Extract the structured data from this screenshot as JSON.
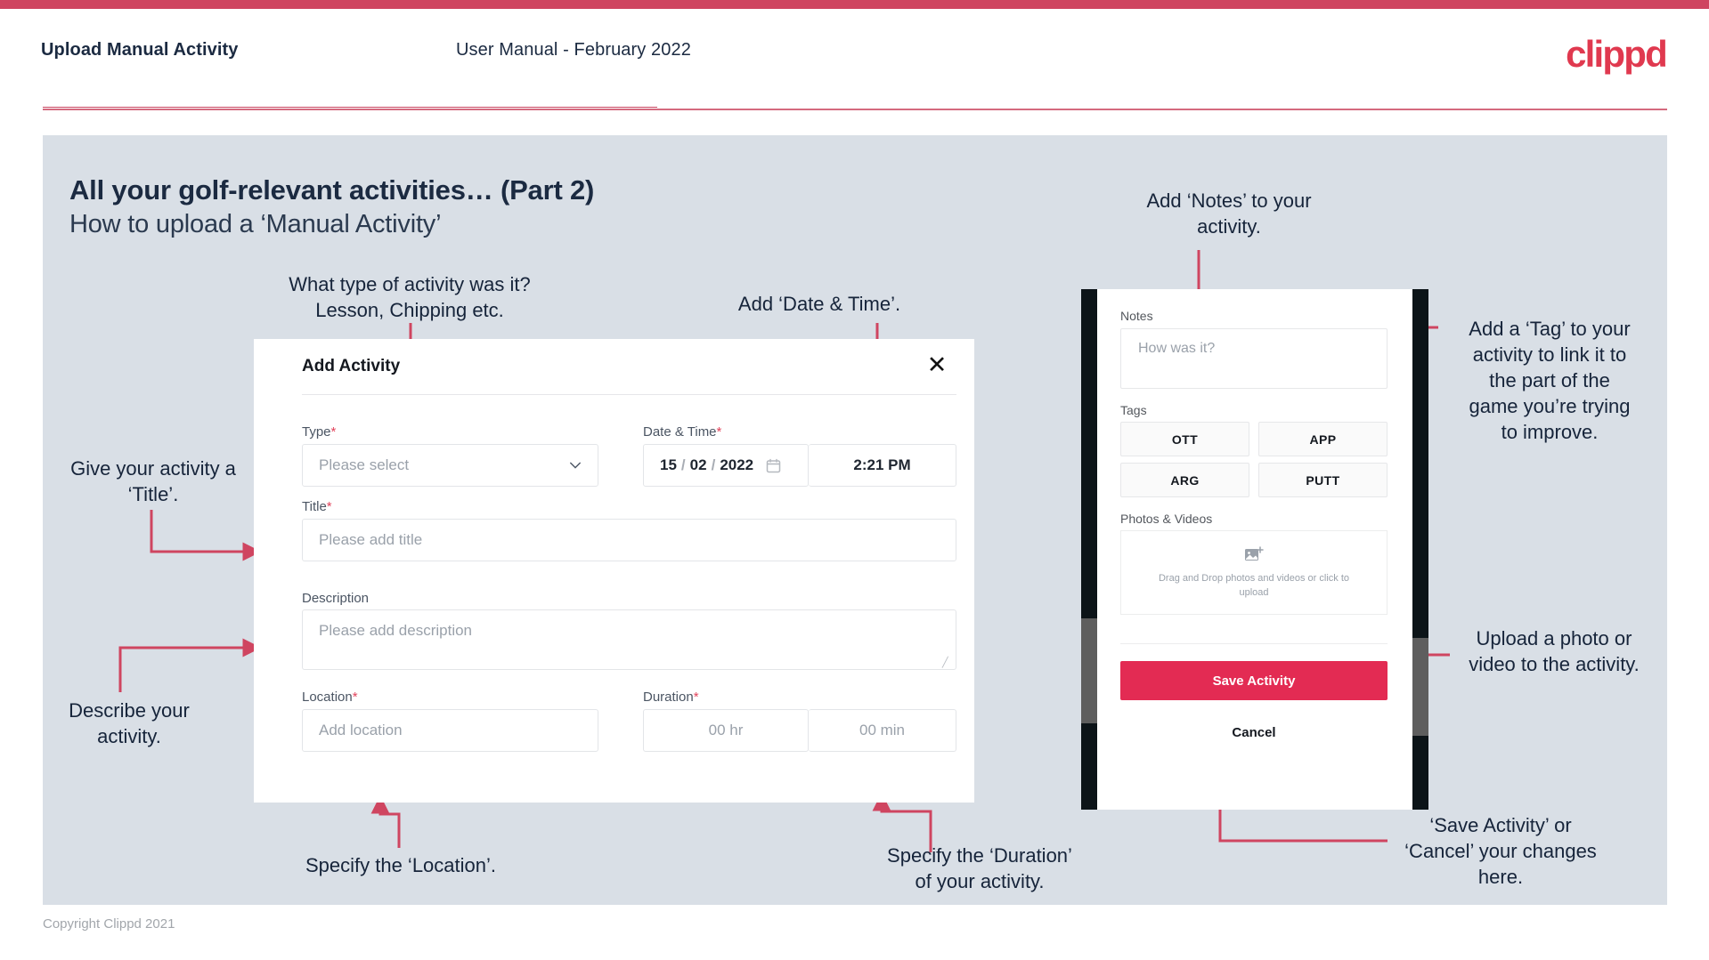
{
  "header": {
    "left_title": "Upload Manual Activity",
    "center_title": "User Manual - February 2022",
    "logo": "clippd"
  },
  "slide": {
    "title": "All your golf-relevant activities… (Part 2)",
    "subtitle": "How to upload a ‘Manual Activity’"
  },
  "annotations": {
    "type_note": "What type of activity was it?\nLesson, Chipping etc.",
    "datetime_note": "Add ‘Date & Time’.",
    "notes_note": "Add ‘Notes’ to your\nactivity.",
    "tag_note": "Add a ‘Tag’ to your\nactivity to link it to\nthe part of the\ngame you’re trying\nto improve.",
    "title_note": "Give your activity a\n‘Title’.",
    "describe_note": "Describe your\nactivity.",
    "location_note": "Specify the ‘Location’.",
    "duration_note": "Specify the ‘Duration’\nof your activity.",
    "upload_note": "Upload a photo or\nvideo to the activity.",
    "save_note": "‘Save Activity’ or\n‘Cancel’ your changes\nhere."
  },
  "dialog": {
    "title": "Add Activity",
    "close_icon": "close-icon",
    "fields": {
      "type": {
        "label": "Type",
        "required": "*",
        "placeholder": "Please select",
        "icon": "chevron-down-icon"
      },
      "datetime": {
        "label": "Date & Time",
        "required": "*",
        "day": "15",
        "sep1": "/",
        "month": "02",
        "sep2": "/",
        "year": "2022",
        "calendar_icon": "calendar-icon",
        "time": "2:21 PM"
      },
      "title": {
        "label": "Title",
        "required": "*",
        "placeholder": "Please add title"
      },
      "description": {
        "label": "Description",
        "required": "",
        "placeholder": "Please add description"
      },
      "location": {
        "label": "Location",
        "required": "*",
        "placeholder": "Add location"
      },
      "duration": {
        "label": "Duration",
        "required": "*",
        "hours": "00 hr",
        "minutes": "00 min"
      }
    }
  },
  "phone": {
    "notes_label": "Notes",
    "notes_placeholder": "How was it?",
    "tags_label": "Tags",
    "tags": [
      "OTT",
      "APP",
      "ARG",
      "PUTT"
    ],
    "photos_label": "Photos & Videos",
    "dropzone_icon": "add-image-icon",
    "dropzone_text": "Drag and Drop photos and videos or click to upload",
    "save_label": "Save Activity",
    "cancel_label": "Cancel"
  },
  "footer": {
    "copyright": "Copyright Clippd 2021"
  },
  "colors": {
    "brand_red": "#e0394f",
    "accent_pink": "#cf4560",
    "save_red": "#e32b53",
    "slide_bg": "#d9dfe6",
    "text_dark": "#1b2a41"
  }
}
